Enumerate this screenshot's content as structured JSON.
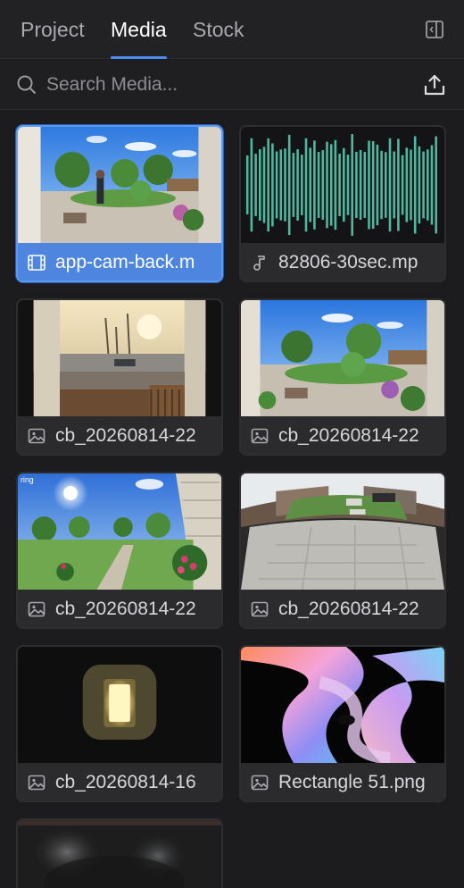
{
  "tabs": [
    {
      "label": "Project",
      "active": false
    },
    {
      "label": "Media",
      "active": true
    },
    {
      "label": "Stock",
      "active": false
    }
  ],
  "header": {
    "panel_toggle_icon": "panel-toggle-icon"
  },
  "search": {
    "placeholder": "Search Media...",
    "value": "",
    "icon": "search-icon",
    "upload_icon": "upload-icon"
  },
  "colors": {
    "accent": "#4a8cf0",
    "selected_caption": "#4e86df",
    "waveform": "#4fb8a0",
    "background": "#1c1c1e"
  },
  "media_items": [
    {
      "name": "app-cam-back.m",
      "type": "video",
      "icon": "film-icon",
      "selected": true
    },
    {
      "name": "82806-30sec.mp",
      "type": "audio",
      "icon": "music-note-icon",
      "selected": false
    },
    {
      "name": "cb_20260814-22",
      "type": "image",
      "icon": "image-icon",
      "selected": false
    },
    {
      "name": "cb_20260814-22",
      "type": "image",
      "icon": "image-icon",
      "selected": false
    },
    {
      "name": "cb_20260814-22",
      "type": "image",
      "icon": "image-icon",
      "selected": false
    },
    {
      "name": "cb_20260814-22",
      "type": "image",
      "icon": "image-icon",
      "selected": false
    },
    {
      "name": "cb_20260814-16",
      "type": "image",
      "icon": "image-icon",
      "selected": false
    },
    {
      "name": "Rectangle 51.png",
      "type": "image",
      "icon": "image-icon",
      "selected": false
    },
    {
      "name": "",
      "type": "image",
      "icon": "image-icon",
      "selected": false
    }
  ]
}
